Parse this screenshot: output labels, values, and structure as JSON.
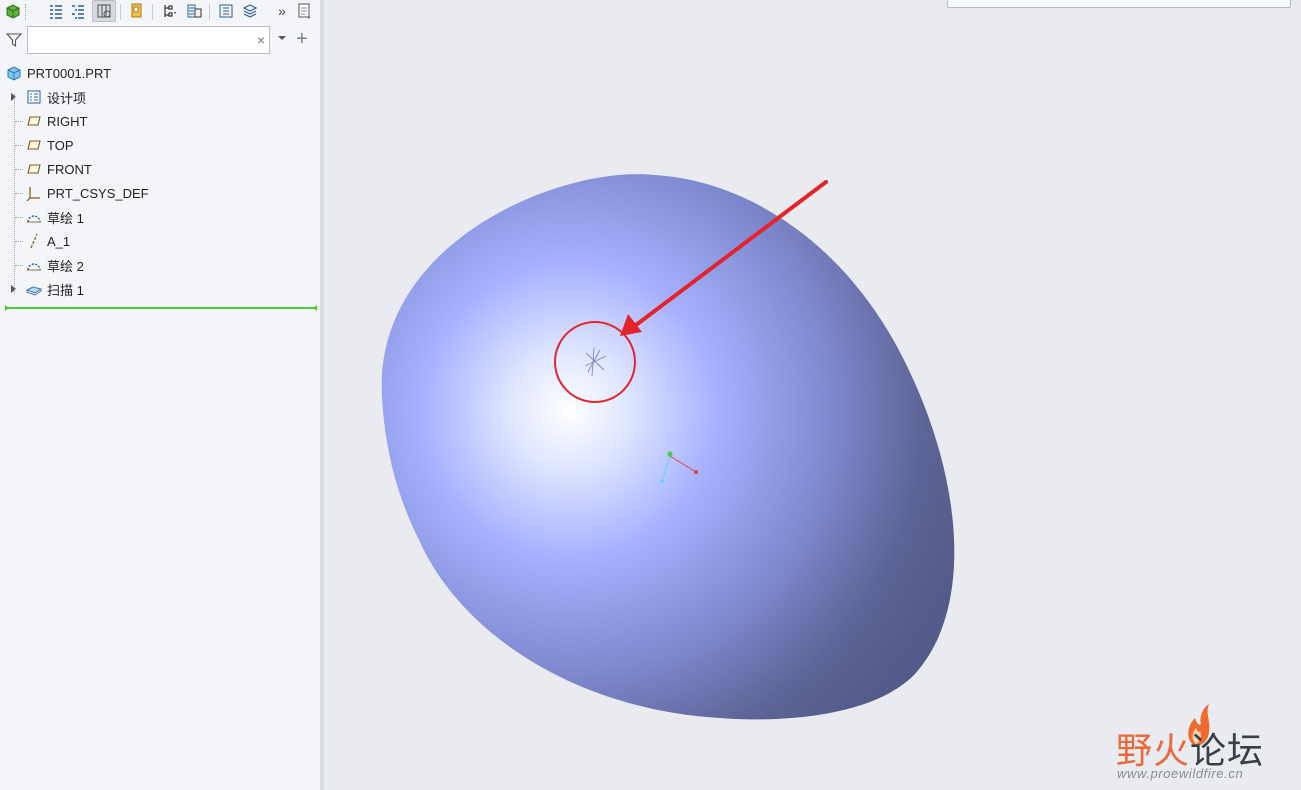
{
  "toolbar": {
    "overflow_label": "»"
  },
  "filter": {
    "value": "",
    "placeholder": "",
    "clear_glyph": "×",
    "add_glyph": "+"
  },
  "tree": {
    "root": "PRT0001.PRT",
    "items": [
      {
        "label": "设计项",
        "icon": "design-items-icon",
        "expandable": true
      },
      {
        "label": "RIGHT",
        "icon": "datum-plane-icon",
        "expandable": false
      },
      {
        "label": "TOP",
        "icon": "datum-plane-icon",
        "expandable": false
      },
      {
        "label": "FRONT",
        "icon": "datum-plane-icon",
        "expandable": false
      },
      {
        "label": "PRT_CSYS_DEF",
        "icon": "coordinate-system-icon",
        "expandable": false
      },
      {
        "label": "草绘 1",
        "icon": "sketch-icon",
        "expandable": false
      },
      {
        "label": "A_1",
        "icon": "datum-axis-icon",
        "expandable": false
      },
      {
        "label": "草绘 2",
        "icon": "sketch-icon",
        "expandable": false
      },
      {
        "label": "扫描 1",
        "icon": "sweep-feature-icon",
        "expandable": true
      }
    ]
  },
  "viewport": {
    "model_color": "#9ea9ff",
    "annotation_color": "#e3242b"
  },
  "watermark": {
    "title_part1": "野火",
    "title_part2": "论坛",
    "url": "www.proewildfire.cn"
  }
}
